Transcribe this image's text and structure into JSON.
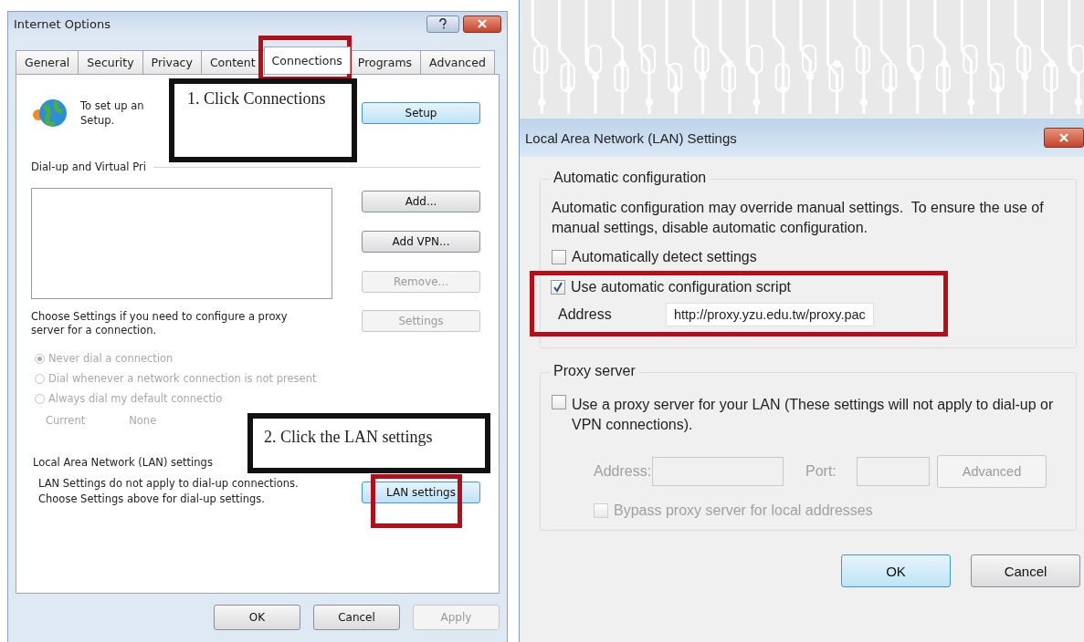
{
  "internet_options": {
    "title": "Internet Options",
    "tabs": [
      {
        "label": "General",
        "selected": false
      },
      {
        "label": "Security",
        "selected": false
      },
      {
        "label": "Privacy",
        "selected": false
      },
      {
        "label": "Content",
        "selected": false
      },
      {
        "label": "Connections",
        "selected": true,
        "highlighted": true
      },
      {
        "label": "Programs",
        "selected": false
      },
      {
        "label": "Advanced",
        "selected": false
      }
    ],
    "setup_text": [
      "To set up an",
      "Setup."
    ],
    "setup_button": {
      "label": "Setup",
      "default": true,
      "disabled": false
    },
    "dialup_heading": "Dial-up and Virtual Pri",
    "side_buttons": [
      {
        "label": "Add...",
        "disabled": false
      },
      {
        "label": "Add VPN...",
        "disabled": false
      },
      {
        "label": "Remove...",
        "disabled": true
      }
    ],
    "proxy_text": "Choose Settings if you need to configure a proxy server for a connection.",
    "settings_button": {
      "label": "Settings",
      "disabled": true
    },
    "dial_options": [
      {
        "label": "Never dial a connection",
        "selected": true
      },
      {
        "label": "Dial whenever a network connection is not present",
        "selected": false
      },
      {
        "label": "Always dial my default connectio",
        "selected": false
      }
    ],
    "current_label": "Current",
    "current_value": "None",
    "lan_heading": "Local Area Network (LAN) settings",
    "lan_text": "LAN Settings do not apply to dial-up connections. Choose Settings above for dial-up settings.",
    "lan_button": {
      "label": "LAN settings",
      "default": true,
      "disabled": false,
      "highlighted": true
    },
    "footer_buttons": [
      {
        "label": "OK",
        "disabled": false
      },
      {
        "label": "Cancel",
        "disabled": false
      },
      {
        "label": "Apply",
        "disabled": true
      }
    ]
  },
  "callouts": [
    {
      "text": "1. Click Connections"
    },
    {
      "text": "2. Click the LAN settings"
    }
  ],
  "lan_dialog": {
    "title": "Local Area Network (LAN) Settings",
    "auto_heading": "Automatic configuration",
    "auto_text": "Automatic configuration may override manual settings.  To ensure the use of manual settings, disable automatic configuration.",
    "auto_detect": {
      "label": "Automatically detect settings",
      "checked": false
    },
    "auto_script": {
      "label": "Use automatic configuration script",
      "checked": true
    },
    "address_label": "Address",
    "address_value": "http://proxy.yzu.edu.tw/proxy.pac",
    "proxy_heading": "Proxy server",
    "use_proxy": {
      "label": "Use a proxy server for your LAN (These settings will not apply to dial-up or VPN connections).",
      "checked": false
    },
    "proxy_address_label": "Address:",
    "port_label": "Port:",
    "advanced_button": {
      "label": "Advanced",
      "disabled": true
    },
    "bypass": {
      "label": "Bypass proxy server for local addresses",
      "checked": false,
      "disabled": true
    },
    "buttons": [
      {
        "label": "OK",
        "default": true
      },
      {
        "label": "Cancel",
        "default": false
      }
    ]
  }
}
